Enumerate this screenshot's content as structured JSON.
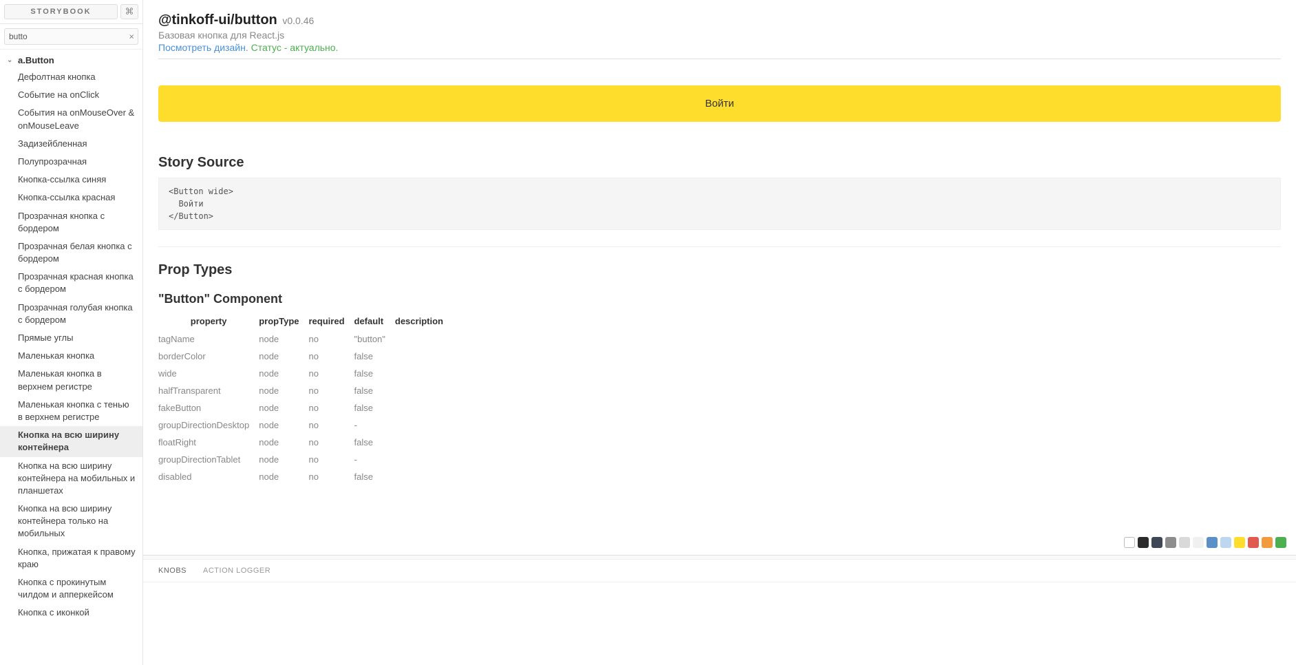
{
  "sidebar": {
    "logo": "STORYBOOK",
    "search_value": "butto",
    "group_label": "a.Button",
    "items": [
      "Дефолтная кнопка",
      "Событие на onClick",
      "События на onMouseOver & onMouseLeave",
      "Задизейбленная",
      "Полупрозрачная",
      "Кнопка-ссылка синяя",
      "Кнопка-ссылка красная",
      "Прозрачная кнопка с бордером",
      "Прозрачная белая кнопка с бордером",
      "Прозрачная красная кнопка с бордером",
      "Прозрачная голубая кнопка с бордером",
      "Прямые углы",
      "Маленькая кнопка",
      "Маленькая кнопка в верхнем регистре",
      "Маленькая кнопка с тенью в верхнем регистре",
      "Кнопка на всю ширину контейнера",
      "Кнопка на всю ширину контейнера на мобильных и планшетах",
      "Кнопка на всю ширину контейнера только на мобильных",
      "Кнопка, прижатая к правому краю",
      "Кнопка с прокинутым чилдом и апперкейсом",
      "Кнопка с иконкой"
    ],
    "active_index": 15
  },
  "header": {
    "pkg": "@tinkoff-ui/button",
    "version": "v0.0.46",
    "desc": "Базовая кнопка для React.js",
    "link_design": "Посмотреть дизайн",
    "status": "Статус - актуально."
  },
  "demo": {
    "button_label": "Войти"
  },
  "source": {
    "title": "Story Source",
    "code": "<Button wide>\n  Войти\n</Button>"
  },
  "props": {
    "title": "Prop Types",
    "component_title": "\"Button\" Component",
    "headers": [
      "property",
      "propType",
      "required",
      "default",
      "description"
    ],
    "rows": [
      {
        "property": "tagName",
        "propType": "node",
        "required": "no",
        "default": "\"button\"",
        "defKind": "str"
      },
      {
        "property": "borderColor",
        "propType": "node",
        "required": "no",
        "default": "false",
        "defKind": "false"
      },
      {
        "property": "wide",
        "propType": "node",
        "required": "no",
        "default": "false",
        "defKind": "false"
      },
      {
        "property": "halfTransparent",
        "propType": "node",
        "required": "no",
        "default": "false",
        "defKind": "false"
      },
      {
        "property": "fakeButton",
        "propType": "node",
        "required": "no",
        "default": "false",
        "defKind": "false"
      },
      {
        "property": "groupDirectionDesktop",
        "propType": "node",
        "required": "no",
        "default": "-",
        "defKind": "plain"
      },
      {
        "property": "floatRight",
        "propType": "node",
        "required": "no",
        "default": "false",
        "defKind": "false"
      },
      {
        "property": "groupDirectionTablet",
        "propType": "node",
        "required": "no",
        "default": "-",
        "defKind": "plain"
      },
      {
        "property": "disabled",
        "propType": "node",
        "required": "no",
        "default": "false",
        "defKind": "false"
      }
    ]
  },
  "swatches": [
    "#ffffff",
    "#2b2b2b",
    "#3e4756",
    "#8d8d8d",
    "#d9d9d9",
    "#f0f0f0",
    "#5a8fc8",
    "#bcd7ef",
    "#ffdd2d",
    "#e05a4f",
    "#f29a3e",
    "#4caf50"
  ],
  "panel": {
    "tabs": [
      "KNOBS",
      "ACTION LOGGER"
    ],
    "active_tab": 0
  }
}
